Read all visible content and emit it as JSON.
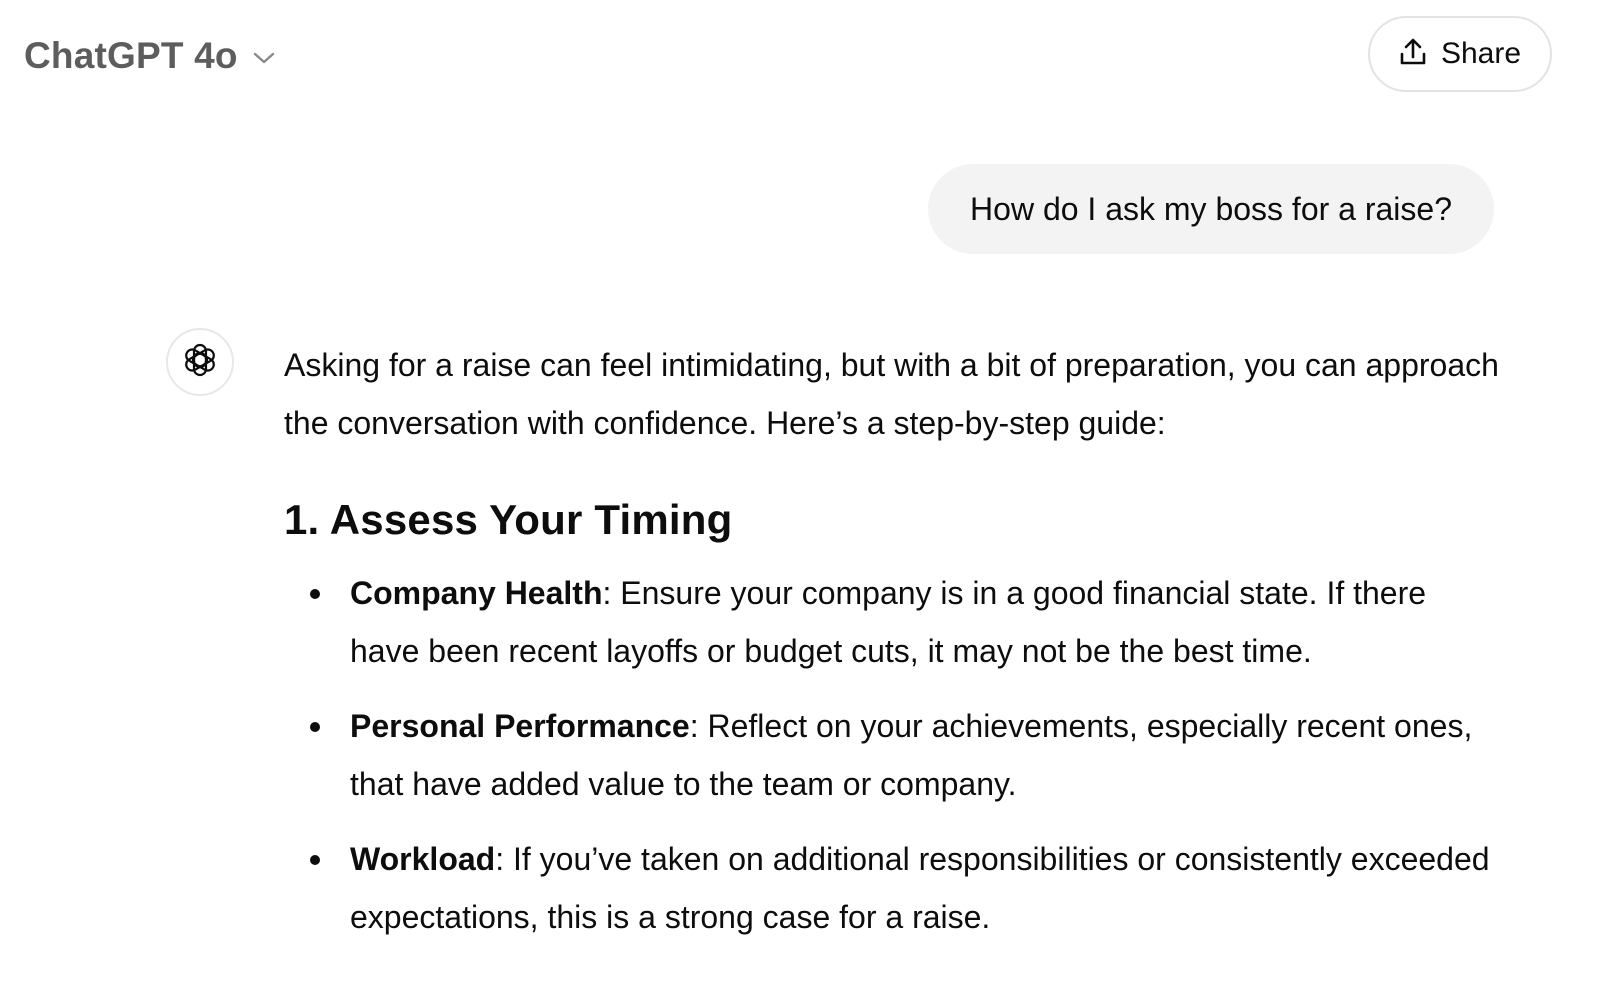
{
  "header": {
    "model_name": "ChatGPT 4o",
    "share_label": "Share"
  },
  "conversation": {
    "user_message": "How do I ask my boss for a raise?",
    "assistant": {
      "intro": "Asking for a raise can feel intimidating, but with a bit of preparation, you can approach the conversation with confidence. Here’s a step-by-step guide:",
      "section_heading": "1. Assess Your Timing",
      "points": [
        {
          "term": "Company Health",
          "text": ": Ensure your company is in a good financial state. If there have been recent layoffs or budget cuts, it may not be the best time."
        },
        {
          "term": "Personal Performance",
          "text": ": Reflect on your achievements, especially recent ones, that have added value to the team or company."
        },
        {
          "term": "Workload",
          "text": ": If you’ve taken on additional responsibilities or consistently exceeded expectations, this is a strong case for a raise."
        }
      ]
    }
  },
  "icons": {
    "model_dropdown": "chevron-down-icon",
    "share": "upload-icon",
    "assistant_avatar": "openai-logo-icon"
  }
}
